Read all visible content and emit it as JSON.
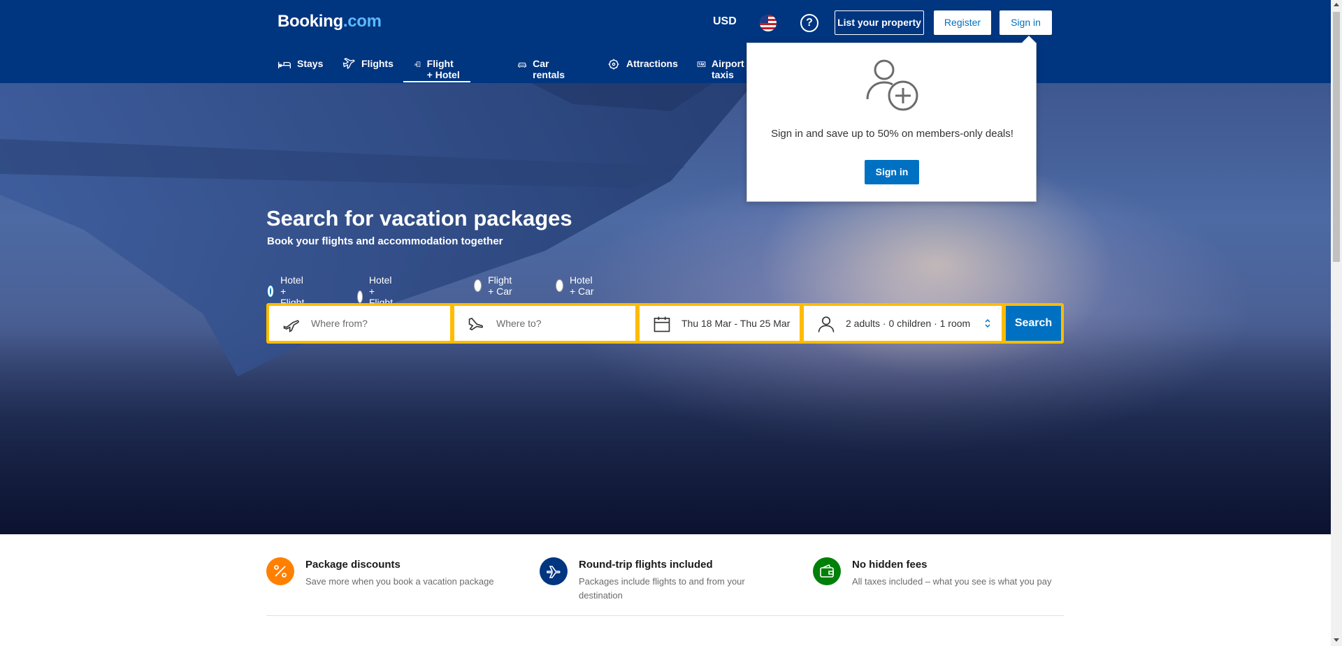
{
  "header": {
    "logo_main": "Booking",
    "logo_suffix": ".com",
    "currency": "USD",
    "flag_icon": "us-flag-icon",
    "help_label": "?",
    "list_property": "List your property",
    "register": "Register",
    "sign_in": "Sign in",
    "bg_color": "#003580"
  },
  "nav": {
    "items": [
      {
        "label": "Stays",
        "icon": "bed-icon"
      },
      {
        "label": "Flights",
        "icon": "plane-icon"
      },
      {
        "label": "Flight + Hotel",
        "icon": "flight-hotel-icon",
        "active": true
      },
      {
        "label": "Car rentals",
        "icon": "car-icon"
      },
      {
        "label": "Attractions",
        "icon": "attractions-icon"
      },
      {
        "label": "Airport taxis",
        "icon": "taxi-icon"
      }
    ]
  },
  "hero": {
    "title": "Search for vacation packages",
    "subtitle": "Book your flights and accommodation together"
  },
  "package_types": {
    "options": [
      "Hotel + Flight",
      "Hotel + Flight + Car",
      "Flight + Car",
      "Hotel + Car"
    ],
    "selected": "Hotel + Flight"
  },
  "search": {
    "from_placeholder": "Where from?",
    "to_placeholder": "Where to?",
    "dates": "Thu 18 Mar - Thu 25 Mar",
    "occupancy": "2 adults · 0 children · 1 room",
    "button": "Search",
    "border_color": "#febb02",
    "button_color": "#0071c2"
  },
  "popover": {
    "text": "Sign in and save up to 50% on members-only deals!",
    "button": "Sign in"
  },
  "features": [
    {
      "title": "Package discounts",
      "desc": "Save more when you book a vacation package",
      "icon": "percent-icon",
      "color": "#ff8000"
    },
    {
      "title": "Round-trip flights included",
      "desc": "Packages include flights to and from your destination",
      "icon": "plane-icon",
      "color": "#003580"
    },
    {
      "title": "No hidden fees",
      "desc": "All taxes included – what you see is what you pay",
      "icon": "wallet-icon",
      "color": "#008009"
    }
  ]
}
